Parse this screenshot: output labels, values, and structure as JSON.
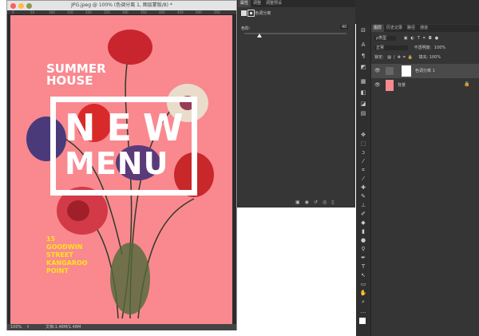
{
  "document": {
    "title": "JPG.jpeg @ 100% (色调分离 1, 图层蒙版/8) *",
    "ruler_ticks": [
      "0",
      "50",
      "100",
      "150",
      "200",
      "250",
      "300",
      "350",
      "400",
      "450",
      "500",
      "550"
    ],
    "zoom": "100%",
    "doc_size": "文档:1.48M/1.48M"
  },
  "artwork": {
    "line1": "SUMMER",
    "line2": "HOUSE",
    "new": "NEW",
    "menu": "MENU",
    "addr": [
      "15",
      "GOODWIN",
      "STREET",
      "KANGAROO",
      "POINT"
    ],
    "bg_color": "#f9898f",
    "accent_color": "#ffe21a"
  },
  "properties": {
    "tabs": [
      "属性",
      "调整",
      "调整预设"
    ],
    "header": "色调分离",
    "levels_label": "色阶:",
    "levels_value": "40",
    "levels_fraction": 0.15
  },
  "layers": {
    "tabs": [
      "图层",
      "历史记录",
      "路径",
      "通道"
    ],
    "filter": "ρ类型",
    "blend": "正常",
    "opacity_label": "不透明度:",
    "opacity": "100%",
    "lock_label": "锁定:",
    "fill_label": "填充:",
    "fill": "100%",
    "items": [
      {
        "name": "色调分离 1",
        "selected": true
      },
      {
        "name": "背景",
        "locked": true
      }
    ]
  }
}
